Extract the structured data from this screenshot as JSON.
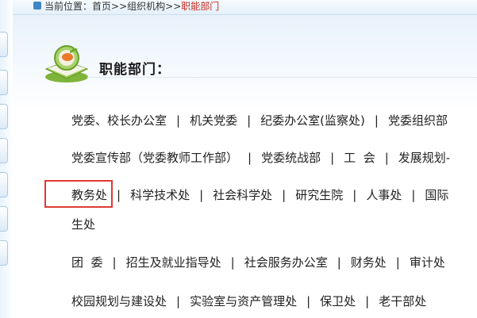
{
  "breadcrumb": {
    "prefix": "当前位置：",
    "home": "首页",
    "sep1": ">>",
    "parent": "组织机构",
    "sep2": ">>",
    "current": "职能部门"
  },
  "section": {
    "title": "职能部门："
  },
  "separator": "|",
  "rows": {
    "r1": [
      "党委、校长办公室",
      "机关党委",
      "纪委办公室(监察处)",
      "党委组织部"
    ],
    "r2": [
      "党委宣传部（党委教师工作部）",
      "党委统战部",
      "工  会",
      "发展规划-"
    ],
    "r3": [
      "教务处",
      "科学技术处",
      "社会科学处",
      "研究生院",
      "人事处",
      "国际"
    ],
    "r3b": "生处",
    "r4": [
      "团  委",
      "招生及就业指导处",
      "社会服务办公室",
      "财务处",
      "审计处"
    ],
    "r5": [
      "校园规划与建设处",
      "实验室与资产管理处",
      "保卫处",
      "老干部处"
    ]
  },
  "colors": {
    "accent": "#c4281c",
    "highlight": "#e03a34",
    "rail": "#a9cbe4"
  },
  "icons": {
    "section": "book-apple-icon"
  }
}
